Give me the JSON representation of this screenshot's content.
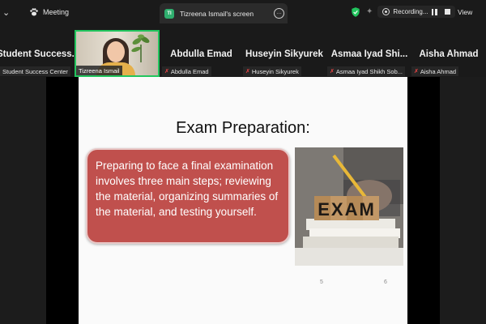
{
  "topbar": {
    "chevron_icon": "chevron-down-icon",
    "meeting_label": "Meeting",
    "share_tab": {
      "badge": "TI",
      "title": "Tizreena Ismail's screen"
    },
    "recording_label": "Recording...",
    "view_label": "View"
  },
  "participants": [
    {
      "name": "Student Success...",
      "label": "Student Success Center",
      "muted": false
    },
    {
      "name": "",
      "label": "Tizreena Ismail",
      "muted": false
    },
    {
      "name": "Abdulla Emad",
      "label": "Abdulla Emad",
      "muted": true
    },
    {
      "name": "Huseyin Sikyurek",
      "label": "Huseyin Sikyurek",
      "muted": true
    },
    {
      "name": "Asmaa Iyad Shi...",
      "label": "Asmaa Iyad Shikh Sob...",
      "muted": true
    },
    {
      "name": "Aisha Ahmad",
      "label": "Aisha Ahmad",
      "muted": true
    }
  ],
  "slide": {
    "title": "Exam Preparation:",
    "body": "Preparing to face a final examination involves three main steps; reviewing the material, organizing summaries of the material, and testing yourself.",
    "photo_text": "EXAM",
    "page_left": "5",
    "page_right": "6"
  },
  "colors": {
    "active_speaker": "#22c55e",
    "textbox_fill": "#c0504d",
    "recording_shield": "#22c55e"
  }
}
